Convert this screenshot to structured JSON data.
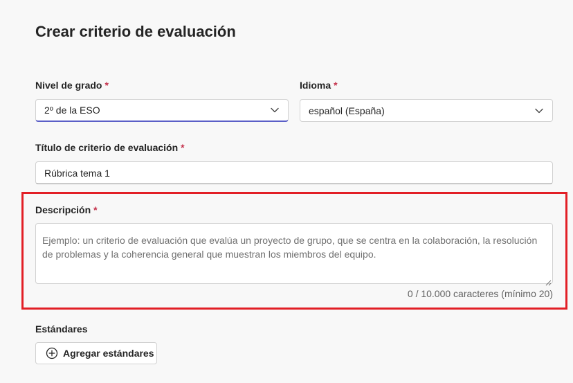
{
  "page": {
    "title": "Crear criterio de evaluación"
  },
  "grade_level": {
    "label": "Nivel de grado",
    "required_mark": "*",
    "value": "2º de la ESO",
    "icon": "chevron-down-icon"
  },
  "language": {
    "label": "Idioma",
    "required_mark": "*",
    "value": "español (España)",
    "icon": "chevron-down-icon"
  },
  "rubric_title": {
    "label": "Título de criterio de evaluación",
    "required_mark": "*",
    "value": "Rúbrica tema 1"
  },
  "description": {
    "label": "Descripción",
    "required_mark": "*",
    "value": "",
    "placeholder": "Ejemplo: un criterio de evaluación que evalúa un proyecto de grupo, que se centra en la colaboración, la resolución de problemas y la coherencia general que muestran los miembros del equipo.",
    "counter": "0 / 10.000 caracteres (mínimo 20)"
  },
  "standards": {
    "label": "Estándares",
    "add_button": "Agregar estándares",
    "icon": "plus-circle-icon"
  },
  "colors": {
    "accent": "#5b5fc7",
    "required": "#c4314b",
    "highlight": "#e21f26"
  }
}
